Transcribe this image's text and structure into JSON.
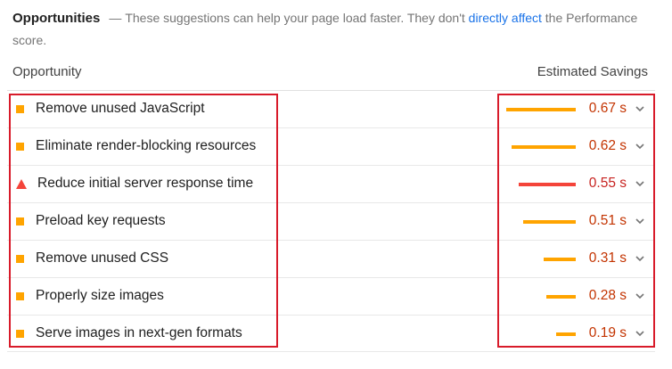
{
  "header": {
    "title": "Opportunities",
    "dash": "—",
    "text_before": "These suggestions can help your page load faster. They don't ",
    "link_text": "directly affect",
    "text_after": " the Performance score."
  },
  "columns": {
    "opportunity": "Opportunity",
    "savings": "Estimated Savings"
  },
  "colors": {
    "average": "#ffa400",
    "fail": "#f4443a",
    "average_text": "#c33300",
    "fail_text": "#c7221f"
  },
  "items": [
    {
      "label": "Remove unused JavaScript",
      "value": "0.67 s",
      "savings_seconds": 0.67,
      "status": "average",
      "icon": "orange-square-icon"
    },
    {
      "label": "Eliminate render-blocking resources",
      "value": "0.62 s",
      "savings_seconds": 0.62,
      "status": "average",
      "icon": "orange-square-icon"
    },
    {
      "label": "Reduce initial server response time",
      "value": "0.55 s",
      "savings_seconds": 0.55,
      "status": "fail",
      "icon": "red-triangle-icon"
    },
    {
      "label": "Preload key requests",
      "value": "0.51 s",
      "savings_seconds": 0.51,
      "status": "average",
      "icon": "orange-square-icon"
    },
    {
      "label": "Remove unused CSS",
      "value": "0.31 s",
      "savings_seconds": 0.31,
      "status": "average",
      "icon": "orange-square-icon"
    },
    {
      "label": "Properly size images",
      "value": "0.28 s",
      "savings_seconds": 0.28,
      "status": "average",
      "icon": "orange-square-icon"
    },
    {
      "label": "Serve images in next-gen formats",
      "value": "0.19 s",
      "savings_seconds": 0.19,
      "status": "average",
      "icon": "orange-square-icon"
    }
  ]
}
